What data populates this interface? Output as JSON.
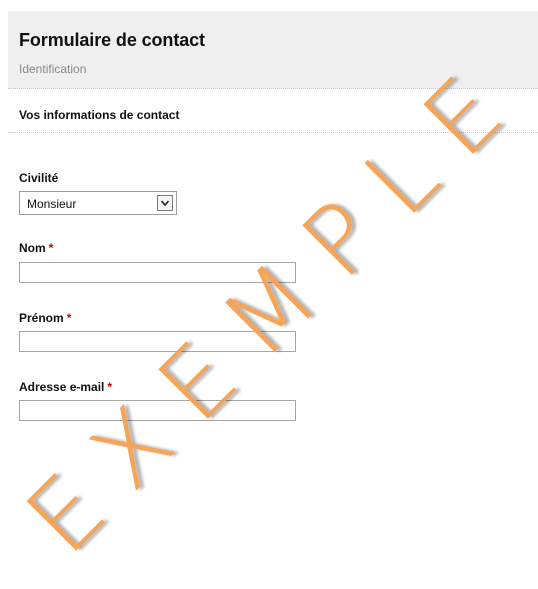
{
  "header": {
    "title": "Formulaire de contact",
    "subtitle": "Identification"
  },
  "section": {
    "title": "Vos informations de contact"
  },
  "fields": {
    "civilite": {
      "label": "Civilité",
      "value": "Monsieur"
    },
    "nom": {
      "label": "Nom",
      "required": "*",
      "value": ""
    },
    "prenom": {
      "label": "Prénom",
      "required": "*",
      "value": ""
    },
    "email": {
      "label": "Adresse e-mail",
      "required": "*",
      "value": ""
    }
  },
  "watermark": {
    "text": "EXEMPLE",
    "color": "#f8a04f"
  },
  "icons": {
    "select_arrow": "chevron-down-icon"
  }
}
